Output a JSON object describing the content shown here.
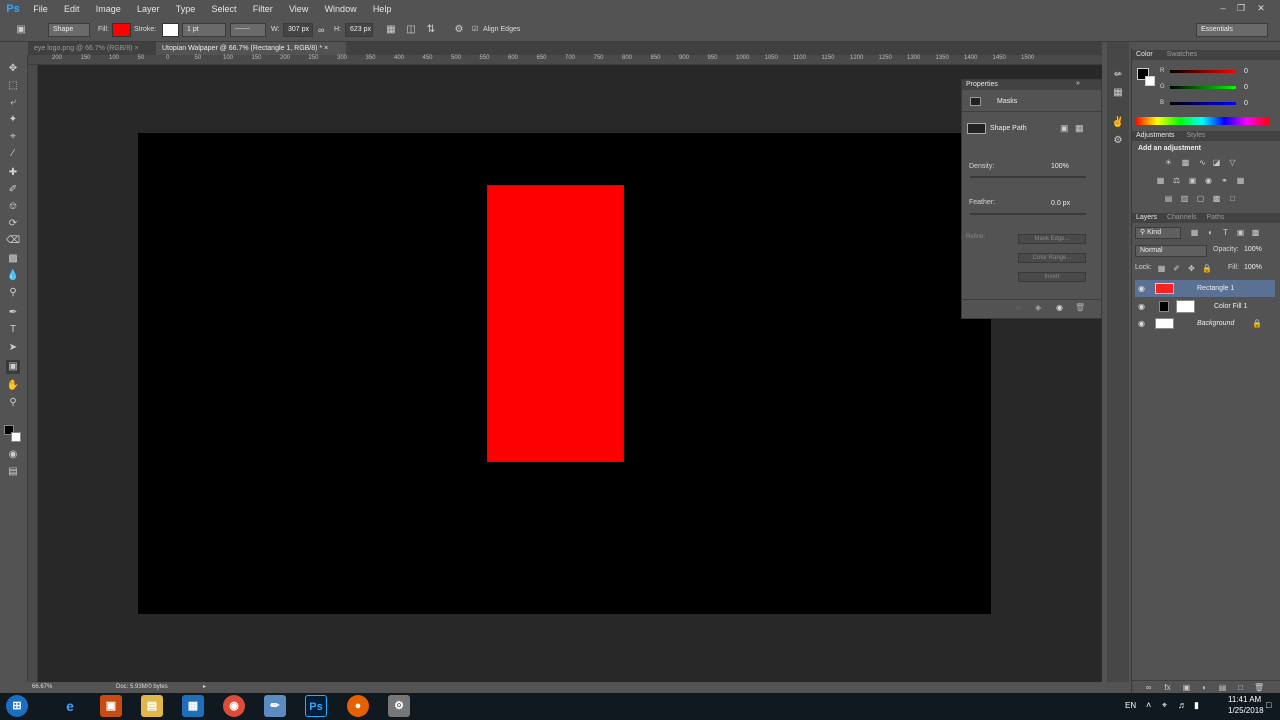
{
  "menubar": {
    "items": [
      "File",
      "Edit",
      "Image",
      "Layer",
      "Type",
      "Select",
      "Filter",
      "View",
      "Window",
      "Help"
    ],
    "logo": "Ps"
  },
  "options": {
    "tool_mode": "Shape",
    "fill_label": "Fill:",
    "stroke_label": "Stroke:",
    "stroke_width": "1 pt",
    "w_label": "W:",
    "w_value": "307 px",
    "h_label": "H:",
    "h_value": "623 px",
    "align_edges": "Align Edges",
    "workspace": "Essentials"
  },
  "tabs": [
    {
      "label": "eye logo.png @ 66.7% (RGB/8)"
    },
    {
      "label": "Utopian Walpaper @ 66.7% (Rectangle 1, RGB/8) *"
    }
  ],
  "ruler_ticks": [
    "200",
    "150",
    "100",
    "50",
    "0",
    "50",
    "100",
    "150",
    "200",
    "250",
    "300",
    "350",
    "400",
    "450",
    "500",
    "550",
    "600",
    "650",
    "700",
    "750",
    "800",
    "850",
    "900",
    "950",
    "1000",
    "1050",
    "1100",
    "1150",
    "1200",
    "1250",
    "1300",
    "1350",
    "1400",
    "1450",
    "1500"
  ],
  "status": {
    "zoom": "66.67%",
    "doc": "Doc: 5.93M/0 bytes"
  },
  "properties": {
    "title": "Properties",
    "section": "Masks",
    "shape_path": "Shape Path",
    "density_label": "Density:",
    "density_value": "100%",
    "feather_label": "Feather:",
    "feather_value": "0.0 px",
    "refine_label": "Refine:",
    "mask_edge": "Mask Edge...",
    "color_range": "Color Range...",
    "invert": "Invert"
  },
  "color_panel": {
    "tabs": [
      "Color",
      "Swatches"
    ],
    "r": "0",
    "g": "0",
    "b": "0",
    "r_label": "R",
    "g_label": "G",
    "b_label": "B"
  },
  "adjustments": {
    "tabs": [
      "Adjustments",
      "Styles"
    ],
    "add_label": "Add an adjustment"
  },
  "layers_panel": {
    "tabs": [
      "Layers",
      "Channels",
      "Paths"
    ],
    "kind": "Kind",
    "blend": "Normal",
    "opacity_label": "Opacity:",
    "opacity": "100%",
    "lock_label": "Lock:",
    "fill_label": "Fill:",
    "fill": "100%",
    "layers": [
      {
        "name": "Rectangle 1",
        "selected": true
      },
      {
        "name": "Color Fill 1",
        "selected": false
      },
      {
        "name": "Background",
        "selected": false
      }
    ]
  },
  "taskbar": {
    "lang": "EN",
    "time": "11:41 AM",
    "date": "1/25/2018"
  },
  "colors": {
    "fill": "#ff0000",
    "canvas": "#000000",
    "workspace": "#282828",
    "panel": "#535353",
    "selection": "#5a7193"
  }
}
